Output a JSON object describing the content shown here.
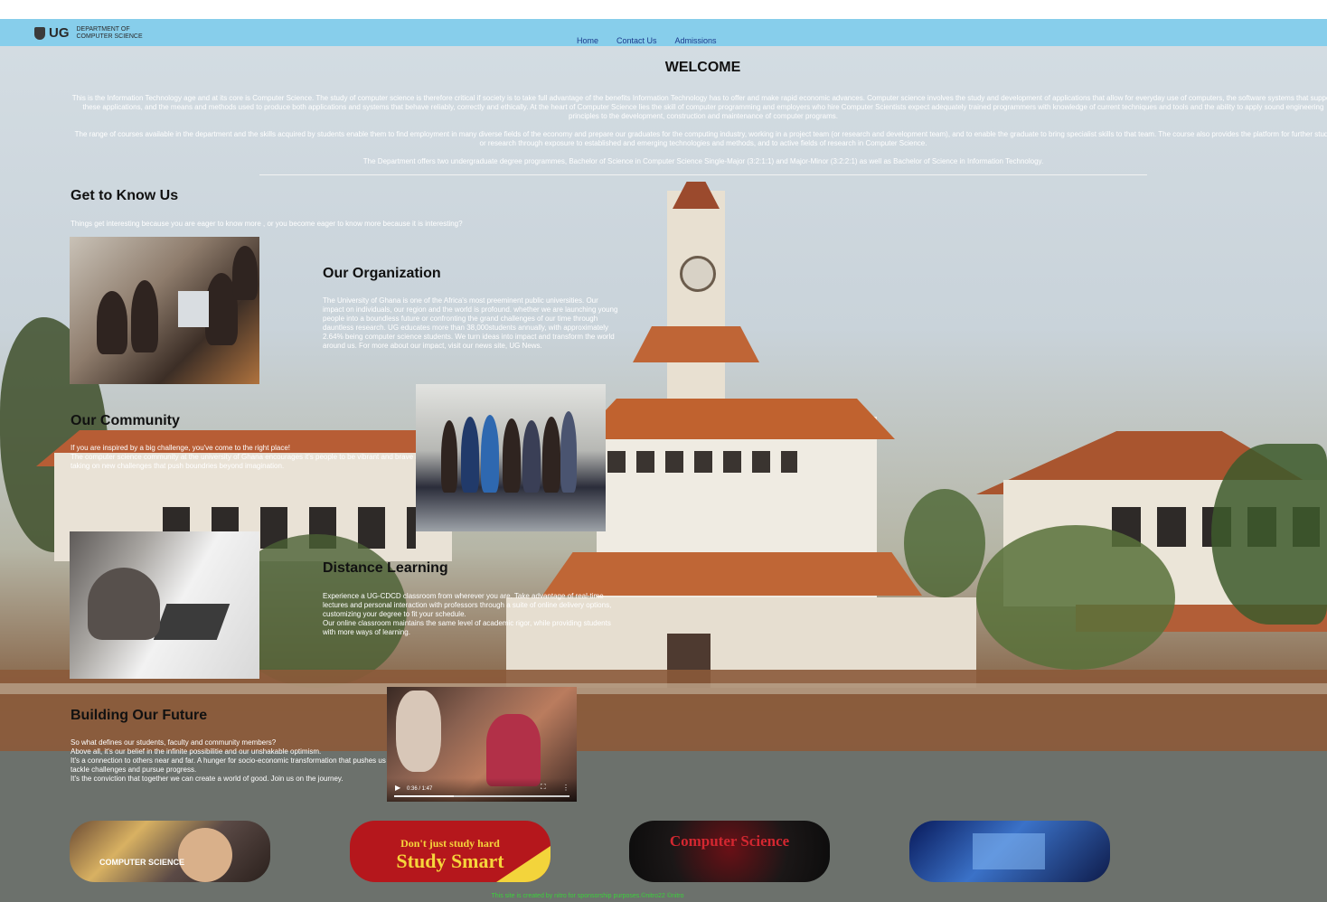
{
  "header": {
    "logo_text": "UG",
    "dept_line1": "DEPARTMENT OF",
    "dept_line2": "COMPUTER SCIENCE",
    "nav": [
      "Home",
      "Contact Us",
      "Admissions"
    ]
  },
  "welcome": {
    "title": "WELCOME",
    "p1": "This is the Information Technology age and at its core is Computer Science. The study of computer science is therefore critical if society is to take full advantage of the benefits Information Technology has to offer and make rapid economic advances. Computer science involves the study and development of applications that allow for everyday use of computers, the software systems that support these applications, and the means and methods used to produce both applications and systems that behave reliably, correctly and ethically. At the heart of Computer Science lies the skill of computer programming and employers who hire Computer Scientists expect adequately trained programmers with knowledge of current techniques and tools and the ability to apply sound engineering principles to the development, construction and maintenance of computer programs.",
    "p2": "The range of courses available in the department and the skills acquired by students enable them to find employment in many diverse fields of the economy and prepare our graduates for the computing industry, working in a project team (or research and development team), and to enable the graduate to bring specialist skills to that team. The course also provides the platform for further study or research through exposure to established and emerging technologies and methods, and to active fields of research in Computer Science.",
    "p3": "The Department offers two undergraduate degree programmes, Bachelor of Science in Computer Science Single-Major (3:2:1:1) and Major-Minor (3:2:2:1) as well as Bachelor of Science in Information Technology."
  },
  "know": {
    "title": "Get to Know Us",
    "text": "Things get interesting because you are eager to know more , or you become eager to know more because it is interesting?"
  },
  "org": {
    "title": "Our Organization",
    "text": "The University of Ghana is one of the Africa's most preeminent public universities. Our impact on individuals, our region and the world is profound. whether we are launching young people into a boundless future or confronting the grand challenges of our time through dauntless research. UG educates more than 38,000students annually, with approximately 2.64% being computer science students. We turn ideas into impact and transform the world around us. For more about our impact, visit our news site, UG News."
  },
  "community": {
    "title": "Our Community",
    "line1": "If you are inspired by a big challenge, you've come to the right place!",
    "line2": "The computer science community at the university of Ghana encourages it's people to be vibrant and brave in taking on new challenges that push boundries beyond imagination."
  },
  "distance": {
    "title": "Distance Learning",
    "line1": "Experience a UG-CDCD classroom from wherever you are. Take advantage of real-time lectures and personal interaction with professors through a suite of online delivery options, customizing your degree to fit your schedule.",
    "line2": "Our online classroom maintains the same level of academic rigor, while providing students with more ways of learning."
  },
  "future": {
    "title": "Building Our Future",
    "line1": "So what defines our students, faculty and community members?",
    "line2": "Above all, it's our belief in the infinite possibilitie and our unshakable optimism.",
    "line3": "It's a connection to others near and far. A hunger for socio-economic transformation that pushes us to tackle challenges and pursue progress.",
    "line4": "It's the conviction that together we can create a world of good. Join us on the journey."
  },
  "video": {
    "time": "0:36 / 1:47",
    "progress_fraction": 0.34
  },
  "banners": {
    "b1_text": "COMPUTER SCIENCE",
    "b2_line1": "Don't just study hard",
    "b2_line2": "Study Smart",
    "b3_text": "Computer Science"
  },
  "footer": "This site is created by nitro for sponsorship purposes.©nitro22 ©nitro",
  "colors": {
    "topbar": "#87ceeb",
    "footer_text": "#3bd23b",
    "nav_link": "#1b3a8c"
  }
}
